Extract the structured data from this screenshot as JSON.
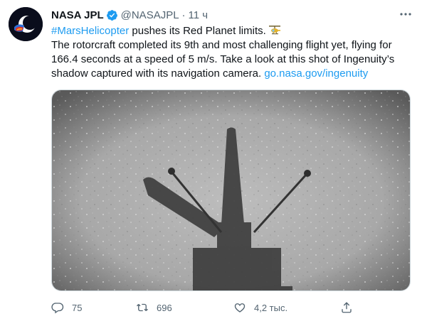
{
  "tweet": {
    "author_name": "NASA JPL",
    "handle": "@NASAJPL",
    "separator": "·",
    "time": "11 ч",
    "hashtag": "#MarsHelicopter",
    "text_line1_rest": " pushes its Red Planet limits.",
    "body": "The rotorcraft completed its 9th and most challenging flight yet, flying for 166.4 seconds at a speed of 5 m/s. Take a look at this shot of Ingenuity’s shadow captured with its navigation camera. ",
    "link": "go.nasa.gov/ingenuity"
  },
  "actions": {
    "reply_count": "75",
    "retweet_count": "696",
    "like_count": "4,2 тыс."
  },
  "colors": {
    "accent": "#1d9bf0",
    "secondary_text": "#536471",
    "primary_text": "#0f1419"
  },
  "icons": [
    "verified-badge-icon",
    "more-icon",
    "helicopter-emoji-icon",
    "reply-icon",
    "retweet-icon",
    "like-icon",
    "share-icon"
  ]
}
